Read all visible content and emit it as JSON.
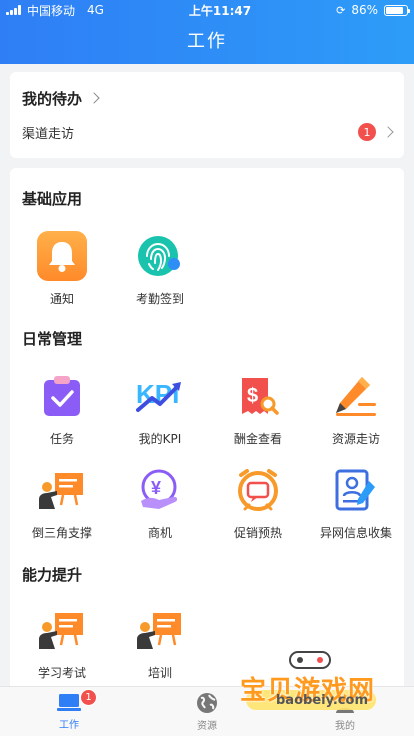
{
  "status": {
    "carrier": "中国移动",
    "network": "4G",
    "time": "上午11:47",
    "battery": "86%",
    "battery_level": 0.86
  },
  "header": {
    "title": "工作"
  },
  "todo": {
    "title": "我的待办",
    "items": [
      {
        "label": "渠道走访",
        "count": "1"
      }
    ]
  },
  "sections": [
    {
      "title": "基础应用",
      "apps": [
        {
          "label": "通知",
          "icon": "bell-icon"
        },
        {
          "label": "考勤签到",
          "icon": "fingerprint-icon"
        }
      ]
    },
    {
      "title": "日常管理",
      "apps": [
        {
          "label": "任务",
          "icon": "task-check-icon"
        },
        {
          "label": "我的KPI",
          "icon": "kpi-icon"
        },
        {
          "label": "酬金查看",
          "icon": "bill-search-icon"
        },
        {
          "label": "资源走访",
          "icon": "pencil-icon"
        },
        {
          "label": "倒三角支撑",
          "icon": "presenter-icon"
        },
        {
          "label": "商机",
          "icon": "yuan-hand-icon"
        },
        {
          "label": "促销预热",
          "icon": "alarm-message-icon"
        },
        {
          "label": "异网信息收集",
          "icon": "id-card-icon"
        }
      ]
    },
    {
      "title": "能力提升",
      "apps": [
        {
          "label": "学习考试",
          "icon": "presenter-icon"
        },
        {
          "label": "培训",
          "icon": "presenter-icon"
        }
      ]
    }
  ],
  "tabbar": {
    "items": [
      {
        "label": "工作",
        "badge": "1",
        "active": true
      },
      {
        "label": "资源"
      },
      {
        "label": "我的"
      }
    ]
  },
  "watermark": {
    "title": "宝贝游戏网",
    "url": "baobeiy.com"
  },
  "colors": {
    "header": "#2f7ef5",
    "badge": "#f2504d",
    "accent": "#2f7ef5"
  }
}
